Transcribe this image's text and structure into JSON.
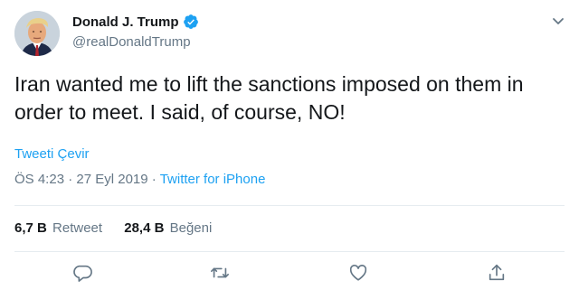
{
  "user": {
    "name": "Donald J. Trump",
    "handle": "@realDonaldTrump"
  },
  "tweet": {
    "text": "Iran wanted me to lift the sanctions imposed on them in order to meet. I said, of course, NO!",
    "translate_label": "Tweeti Çevir",
    "time": "ÖS 4:23",
    "sep1": " · ",
    "date": "27 Eyl 2019",
    "sep2": " · ",
    "source": "Twitter for iPhone"
  },
  "stats": {
    "retweets_count": "6,7 B",
    "retweets_label": "Retweet",
    "likes_count": "28,4 B",
    "likes_label": "Beğeni"
  },
  "icons": {
    "verified": "verified-badge-icon",
    "menu": "chevron-down-icon",
    "reply": "reply-icon",
    "retweet": "retweet-icon",
    "like": "heart-icon",
    "share": "share-icon"
  },
  "colors": {
    "accent": "#1da1f2",
    "secondary_text": "#657786",
    "primary_text": "#14171a",
    "divider": "#e6ecf0"
  }
}
